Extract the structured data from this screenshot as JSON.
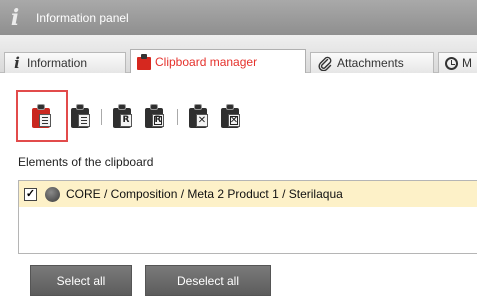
{
  "titlebar": {
    "icon": "info-icon",
    "title": "Information panel"
  },
  "tabs": [
    {
      "label": "Information",
      "icon": "info-icon",
      "active": false
    },
    {
      "label": "Clipboard manager",
      "icon": "clipboard-icon",
      "active": true
    },
    {
      "label": "Attachments",
      "icon": "paperclip-icon",
      "active": false
    },
    {
      "label": "M",
      "icon": "clock-icon",
      "active": false
    }
  ],
  "toolbar": {
    "buttons": [
      {
        "name": "paste-list-button",
        "icon": "clipboard-list-red-icon",
        "active": true
      },
      {
        "name": "paste-table-button",
        "icon": "clipboard-table-icon",
        "active": false
      },
      {
        "name": "paste-ref-button",
        "icon": "clipboard-r-icon",
        "active": false
      },
      {
        "name": "paste-ref-boxed-button",
        "icon": "clipboard-r-boxed-icon",
        "active": false
      },
      {
        "name": "clear-clipboard-button",
        "icon": "clipboard-x-icon",
        "active": false
      },
      {
        "name": "clear-clipboard-boxed-button",
        "icon": "clipboard-x-boxed-icon",
        "active": false
      }
    ],
    "glyph_r": "R",
    "glyph_x": "✕"
  },
  "elements_label": "Elements of the clipboard",
  "clipboard_items": [
    {
      "checked": true,
      "check_mark": "✓",
      "status_color": "#4a4a4a",
      "text": "CORE / Composition / Meta 2 Product 1 / Sterilaqua"
    }
  ],
  "buttons": {
    "select_all": "Select all",
    "deselect_all": "Deselect all"
  },
  "colors": {
    "accent": "#e5322c",
    "highlight_row": "#fdf1c8",
    "titlebar": "#9a9a9a",
    "button": "#6b6b6b"
  }
}
